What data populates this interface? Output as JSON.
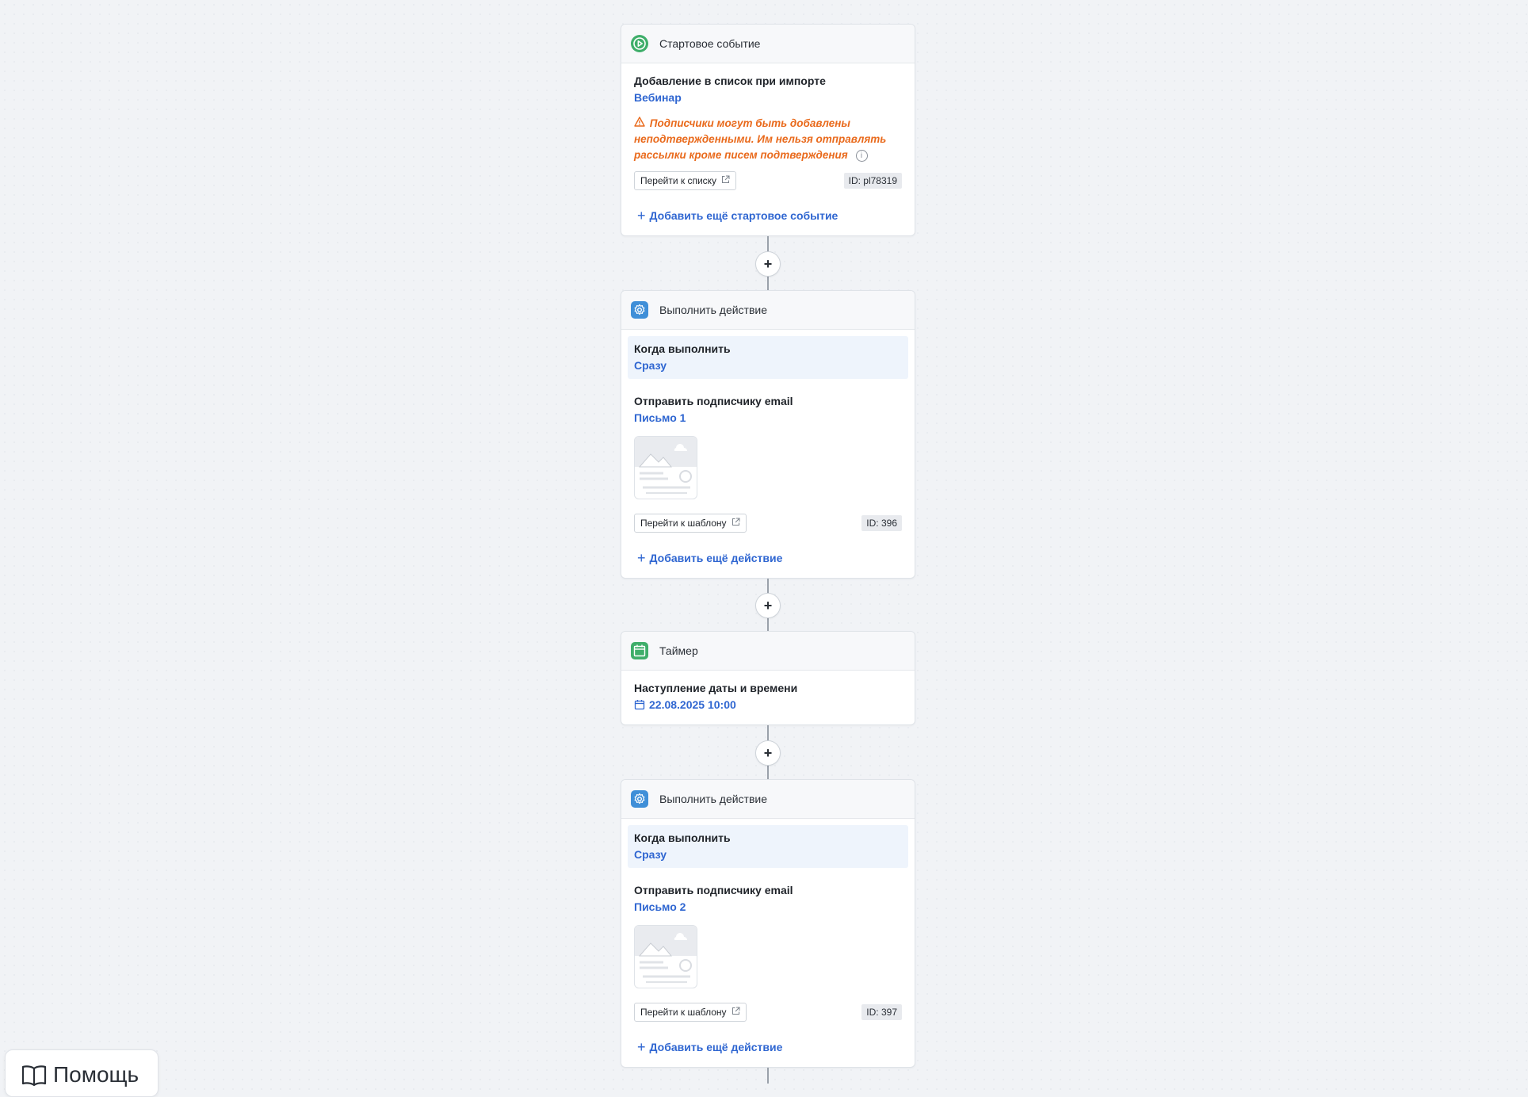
{
  "start": {
    "header": "Стартовое событие",
    "title": "Добавление в список при импорте",
    "list_link": "Вебинар",
    "warning": "Подписчики могут быть добавлены неподтвержденными. Им нельзя отправлять рассылки кроме писем подтверждения",
    "go_button": "Перейти к списку",
    "id": "ID: pl78319",
    "add_more": "Добавить ещё стартовое событие"
  },
  "action1": {
    "header": "Выполнить действие",
    "when_title": "Когда выполнить",
    "when_value": "Сразу",
    "send_title": "Отправить подписчику email",
    "letter": "Письмо 1",
    "go_button": "Перейти к шаблону",
    "id": "ID: 396",
    "add_more": "Добавить ещё действие"
  },
  "timer": {
    "header": "Таймер",
    "title": "Наступление даты и времени",
    "datetime": "22.08.2025 10:00"
  },
  "action2": {
    "header": "Выполнить действие",
    "when_title": "Когда выполнить",
    "when_value": "Сразу",
    "send_title": "Отправить подписчику email",
    "letter": "Письмо 2",
    "go_button": "Перейти к шаблону",
    "id": "ID: 397",
    "add_more": "Добавить ещё действие"
  },
  "connector_plus": "+",
  "help": {
    "label": "Помощь"
  },
  "icons": {
    "start": "play-icon",
    "action": "gear-icon",
    "timer": "calendar-icon",
    "warning": "warning-triangle-icon",
    "info": "info-icon",
    "external": "external-link-icon",
    "plus": "plus-icon",
    "help": "book-icon"
  },
  "colors": {
    "accent_link": "#2f66d1",
    "warning": "#e96a1c",
    "green": "#3fae6a",
    "blue": "#3f8fd8"
  }
}
